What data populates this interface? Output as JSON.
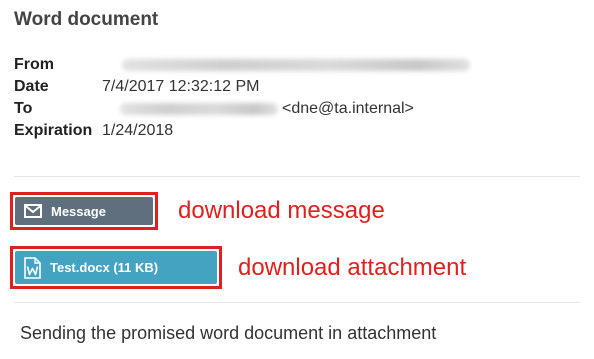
{
  "email": {
    "title": "Word document",
    "fields": [
      {
        "label": "From",
        "value": ""
      },
      {
        "label": "Date",
        "value": "7/4/2017 12:32:12 PM"
      },
      {
        "label": "To",
        "value": "<dne@ta.internal>"
      },
      {
        "label": "Expiration",
        "value": "1/24/2018"
      }
    ],
    "body": "Sending the promised word document in attachment"
  },
  "actions": {
    "message_button": {
      "label": "Message",
      "icon": "envelope-icon"
    },
    "attachment_button": {
      "label": "Test.docx (11 KB)",
      "icon": "word-doc-icon"
    }
  },
  "annotations": {
    "message": "download message",
    "attachment": "download attachment"
  },
  "colors": {
    "highlight": "#e0201d",
    "message_button": "#5f6f7d",
    "attachment_button": "#45a3c2"
  }
}
